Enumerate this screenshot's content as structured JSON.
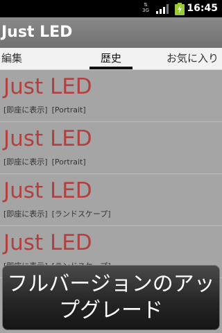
{
  "status_bar": {
    "network": "3G",
    "time": "16:45"
  },
  "header": {
    "title": "Just LED"
  },
  "tabs": [
    {
      "label": "編集"
    },
    {
      "label": "歴史"
    },
    {
      "label": "お気に入り"
    }
  ],
  "list": {
    "items": [
      {
        "title": "Just LED",
        "mode": "[即座に表示]",
        "orientation": "[Portrait]"
      },
      {
        "title": "Just LED",
        "mode": "[即座に表示]",
        "orientation": "[Portrait]"
      },
      {
        "title": "Just LED",
        "mode": "[即座に表示]",
        "orientation": "[ランドスケープ]"
      },
      {
        "title": "Just LED",
        "mode": "[即座に表示]",
        "orientation": "[ランドスケープ]"
      }
    ]
  },
  "upgrade": {
    "label": "フルバージョンのアップグレード"
  },
  "colors": {
    "item_title": "#b34040",
    "background": "#a5a5a5",
    "banner": "#262626"
  }
}
